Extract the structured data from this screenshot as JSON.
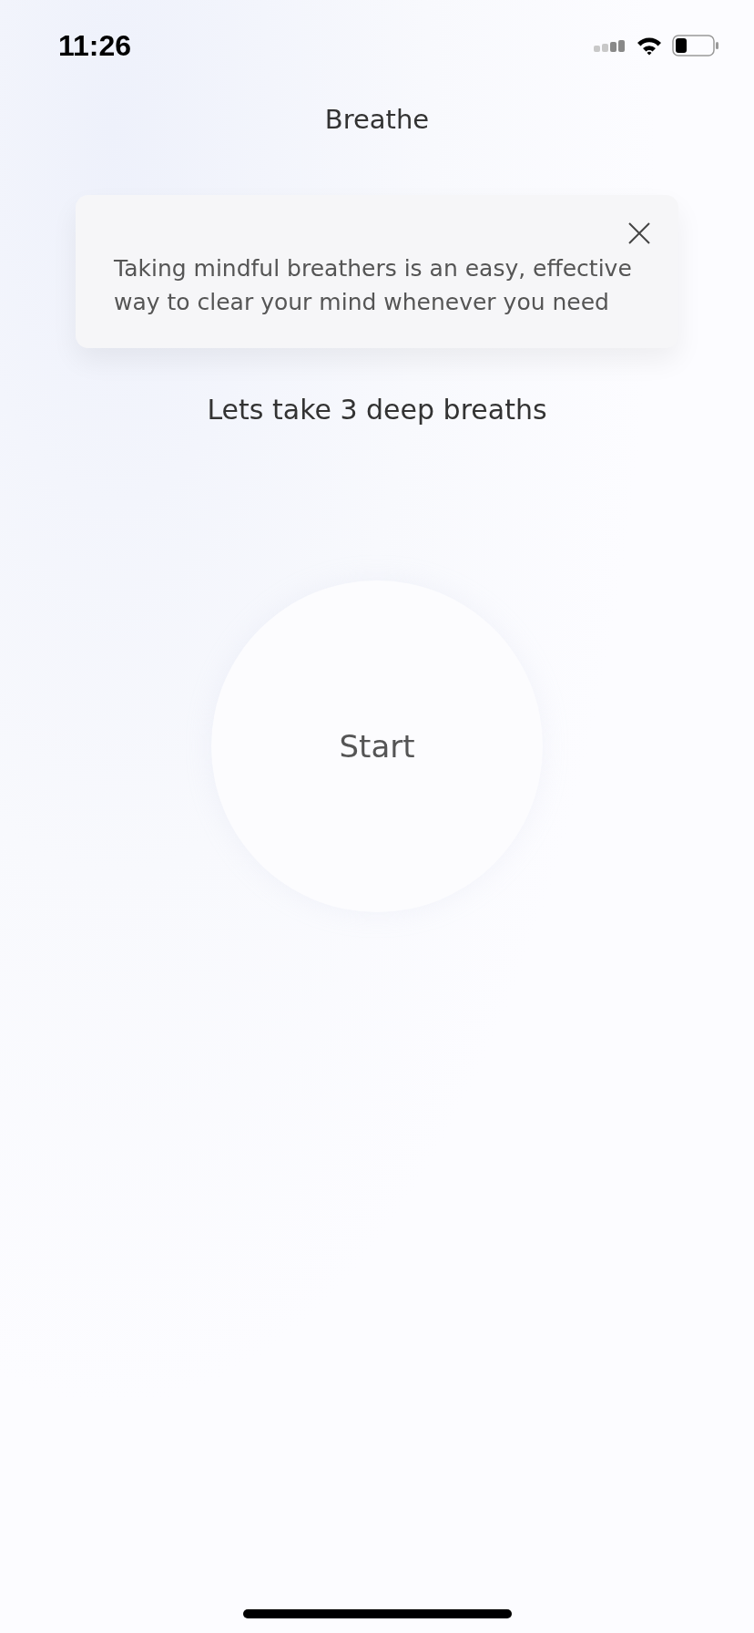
{
  "status_bar": {
    "time": "11:26"
  },
  "header": {
    "title": "Breathe"
  },
  "info_card": {
    "text": "Taking mindful breathers is an easy, effective way to clear your mind whenever you need"
  },
  "prompt": "Lets take 3 deep breaths",
  "start_button": {
    "label": "Start"
  }
}
